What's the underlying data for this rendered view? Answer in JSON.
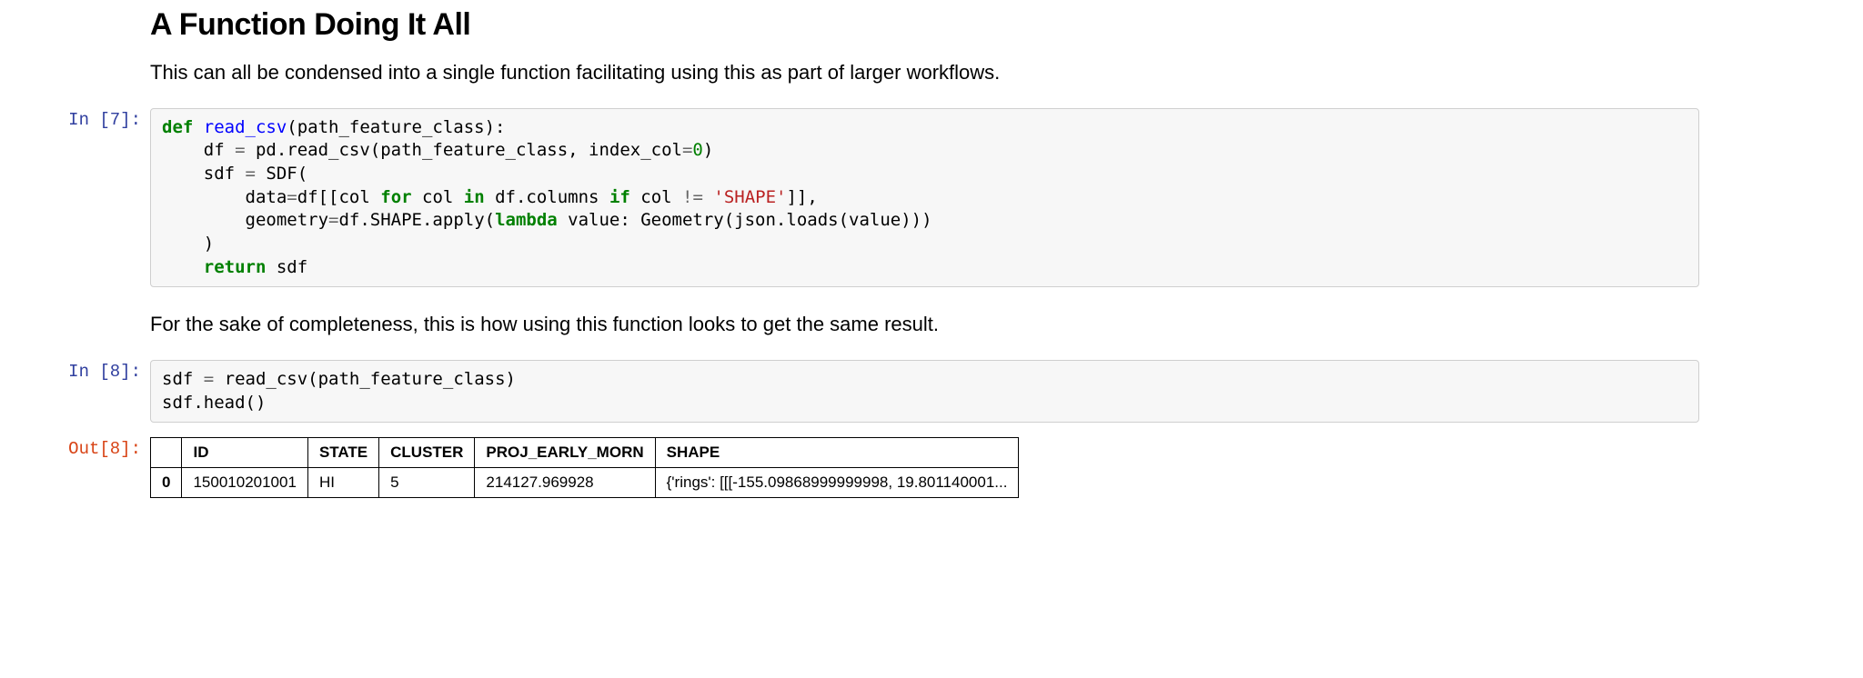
{
  "heading": "A Function Doing It All",
  "paragraph1": "This can all be condensed into a single function facilitating using this as part of larger workflows.",
  "cell7": {
    "prompt": "In [7]:",
    "code": {
      "l1_def": "def",
      "l1_func": " read_csv",
      "l1_args": "(path_feature_class):",
      "l2_pre": "    df ",
      "l2_eq": "=",
      "l2_post": " pd.read_csv(path_feature_class, index_col",
      "l2_eq2": "=",
      "l2_zero": "0",
      "l2_end": ")",
      "l3_pre": "    sdf ",
      "l3_eq": "=",
      "l3_post": " SDF(",
      "l4_pre": "        data",
      "l4_eq": "=",
      "l4_mid": "df[[col ",
      "l4_for": "for",
      "l4_col": " col ",
      "l4_in": "in",
      "l4_cols": " df.columns ",
      "l4_if": "if",
      "l4_ne": " col ",
      "l4_op": "!=",
      "l4_str": " 'SHAPE'",
      "l4_end": "]],",
      "l5_pre": "        geometry",
      "l5_eq": "=",
      "l5_mid": "df.SHAPE.apply(",
      "l5_lambda": "lambda",
      "l5_post": " value: Geometry(json.loads(value)))",
      "l6": "    )",
      "l7_return": "    return",
      "l7_post": " sdf"
    }
  },
  "paragraph2": "For the sake of completeness, this is how using this function looks to get the same result.",
  "cell8": {
    "prompt": "In [8]:",
    "code": {
      "l1_pre": "sdf ",
      "l1_eq": "=",
      "l1_post": " read_csv(path_feature_class)",
      "l2": "sdf.head()"
    }
  },
  "out8": {
    "prompt": "Out[8]:",
    "table": {
      "headers": [
        "",
        "ID",
        "STATE",
        "CLUSTER",
        "PROJ_EARLY_MORN",
        "SHAPE"
      ],
      "rows": [
        [
          "0",
          "150010201001",
          "HI",
          "5",
          "214127.969928",
          "{'rings': [[[-155.09868999999998, 19.801140001..."
        ]
      ]
    }
  }
}
